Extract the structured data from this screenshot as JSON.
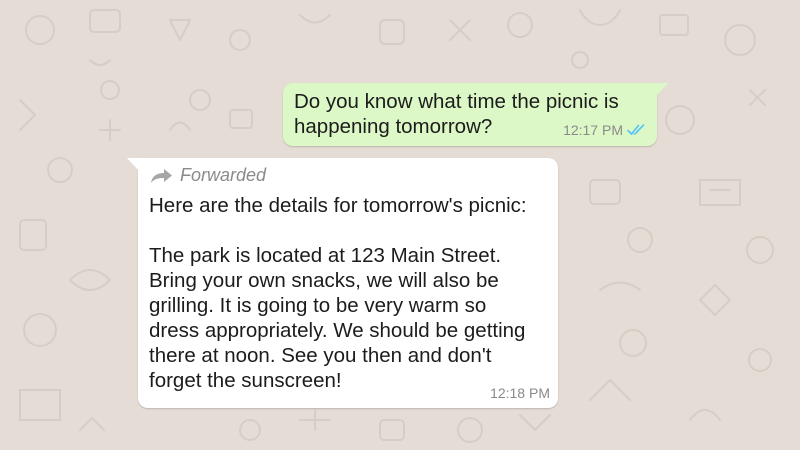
{
  "chat": {
    "outgoing": {
      "text": "Do you know what time the picnic is\nhappening tomorrow?",
      "time": "12:17 PM",
      "status_icon": "double-check-icon"
    },
    "incoming": {
      "forwarded_label": "Forwarded",
      "forward_icon": "forward-arrow-icon",
      "text": "Here are the details for tomorrow's picnic:\n\nThe park is located at 123 Main Street.\nBring your own snacks, we will also be\ngrilling. It is going to be very warm so\ndress appropriately. We should be getting\nthere at noon. See you then and don't\nforget the sunscreen!",
      "time": "12:18 PM"
    }
  },
  "colors": {
    "wallpaper": "#e5ddd5",
    "outgoing_bubble": "#dcf8c6",
    "incoming_bubble": "#ffffff",
    "read_ticks": "#4fc3f7"
  }
}
